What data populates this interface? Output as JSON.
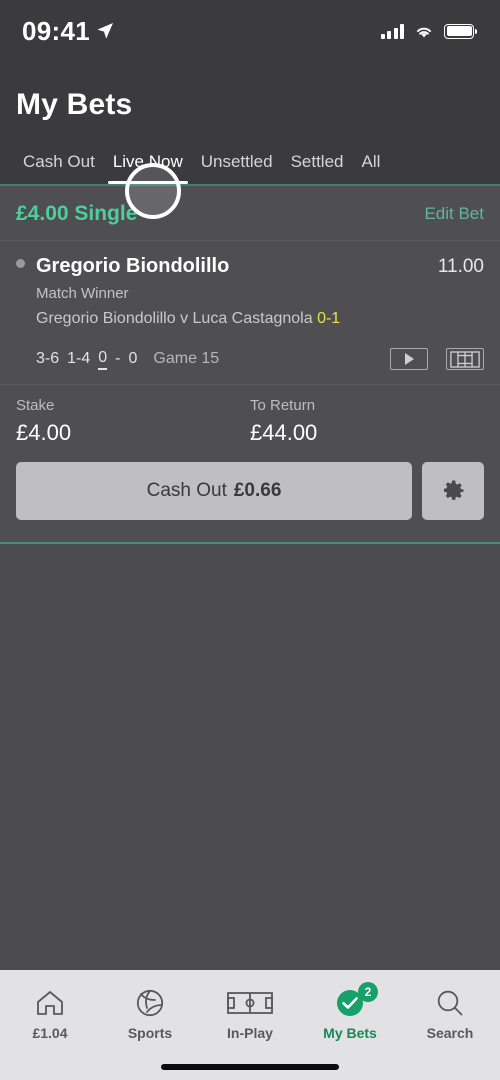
{
  "status_bar": {
    "time": "09:41",
    "location_icon": "location-arrow-icon",
    "signal_icon": "cellular-signal-icon",
    "wifi_icon": "wifi-icon",
    "battery_icon": "battery-full-icon"
  },
  "header": {
    "title": "My Bets"
  },
  "tabs": [
    {
      "label": "Cash Out",
      "active": false
    },
    {
      "label": "Live Now",
      "active": true
    },
    {
      "label": "Unsettled",
      "active": false
    },
    {
      "label": "Settled",
      "active": false
    },
    {
      "label": "All",
      "active": false
    }
  ],
  "bet": {
    "header_title": "£4.00 Single",
    "edit_label": "Edit Bet",
    "selection": {
      "name": "Gregorio Biondolillo",
      "odds": "11.00",
      "market": "Match Winner",
      "event": "Gregorio Biondolillo v Luca Castagnola",
      "event_score": "0-1"
    },
    "live_score": {
      "set1": "3-6",
      "set2": "1-4",
      "current_home": "0",
      "current_sep": "-",
      "current_away": "0",
      "game": "Game 15",
      "stream_icon": "video-stream-icon",
      "stats_icon": "court-stats-icon"
    },
    "stake_label": "Stake",
    "stake_value": "£4.00",
    "return_label": "To Return",
    "return_value": "£44.00",
    "cashout_label": "Cash Out",
    "cashout_value": "£0.66",
    "settings_icon": "gear-icon"
  },
  "bottom_nav": [
    {
      "label": "£1.04",
      "icon": "home-icon",
      "active": false,
      "badge": ""
    },
    {
      "label": "Sports",
      "icon": "football-icon",
      "active": false,
      "badge": ""
    },
    {
      "label": "In-Play",
      "icon": "pitch-icon",
      "active": false,
      "badge": ""
    },
    {
      "label": "My Bets",
      "icon": "check-circle-icon",
      "active": true,
      "badge": "2"
    },
    {
      "label": "Search",
      "icon": "search-icon",
      "active": false,
      "badge": ""
    }
  ],
  "colors": {
    "accent_green": "#4ece9b",
    "nav_active_green": "#178a54",
    "score_yellow": "#e8e04a",
    "background": "#4c4c4e"
  }
}
